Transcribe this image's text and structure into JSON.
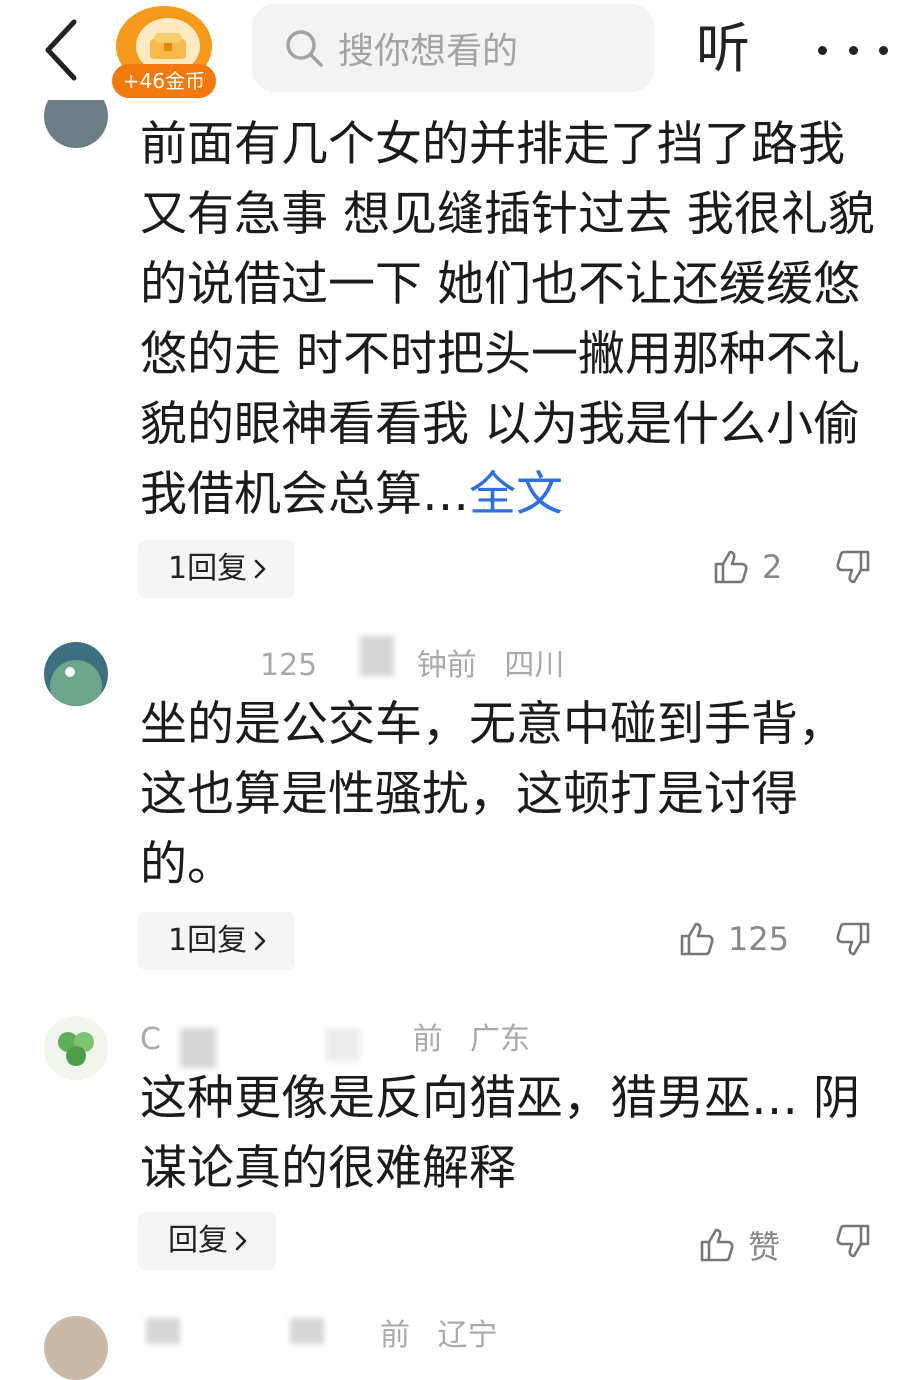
{
  "header": {
    "coin_badge": "+46金币",
    "coin_icon": "coin-chest-icon",
    "search_placeholder": "搜你想看的",
    "listen_label": "听"
  },
  "comments": [
    {
      "body": "前面有几个女的并排走了挡了路我又有急事 想见缝插针过去 我很礼貌的说借过一下 她们也不让还缓缓悠悠的走 时不时把头一撇用那种不礼貌的眼神看看我 以为我是什么小偷 我借机会总算…",
      "full_text_link": "全文",
      "reply_label": "1回复",
      "likes": "2"
    },
    {
      "meta_user": "125",
      "meta_time": "钟前",
      "meta_location": "四川",
      "body": "坐的是公交车，无意中碰到手背，这也算是性骚扰，这顿打是讨得的。",
      "reply_label": "1回复",
      "likes": "125"
    },
    {
      "meta_user": "C",
      "meta_time": "前",
      "meta_location": "广东",
      "body": "这种更像是反向猎巫，猎男巫… 阴谋论真的很难解释",
      "reply_label": "回复",
      "likes": "赞"
    },
    {
      "meta_time": "前",
      "meta_location": "辽宁"
    }
  ],
  "colors": {
    "accent_link": "#2f6fe0",
    "coin_orange": "#f2790d",
    "meta_gray": "#a9a9a9"
  }
}
